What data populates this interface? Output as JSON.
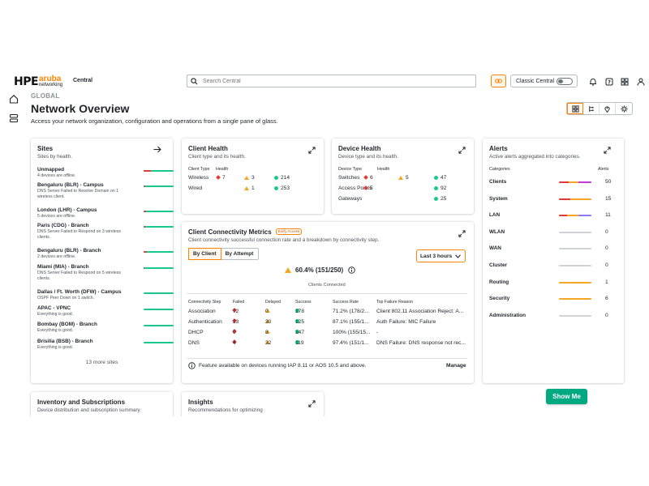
{
  "header": {
    "logo_hpe": "HPE",
    "logo_aruba": "aruba",
    "logo_networking": "networking",
    "app_name": "Central",
    "search_placeholder": "Search Central",
    "classic_label": "Classic Central"
  },
  "page": {
    "breadcrumb": "GLOBAL",
    "title": "Network Overview",
    "subtitle": "Access your network organization, configuration and operations from a single pane of glass."
  },
  "sites": {
    "title": "Sites",
    "subtitle": "Sites by health.",
    "items": [
      {
        "name": "Unmapped",
        "desc": "4 devices are offline.",
        "red": 0.25
      },
      {
        "name": "Bengaluru (BLR) - Campus",
        "desc": "DNS Server Failed to Resolve Domain on 1 wireless client.",
        "red": 0.05
      },
      {
        "name": "London (LHR) - Campus",
        "desc": "5 devices are offline.",
        "red": 0.08
      },
      {
        "name": "Paris (CDG) - Branch",
        "desc": "DNS Server Failed to Respond on 3 wireless clients.",
        "red": 0.05
      },
      {
        "name": "Bengaluru (BLR) - Branch",
        "desc": "2 devices are offline.",
        "red": 0.1
      },
      {
        "name": "Miami (MIA) - Branch",
        "desc": "DNS Server Failed to Respond on 5 wireless clients.",
        "red": 0.03
      },
      {
        "name": "Dallas / Ft. Worth (DFW) - Campus",
        "desc": "OSPF Peer Down on 1 switch.",
        "red": 0
      },
      {
        "name": "APAC - VPNC",
        "desc": "Everything is good.",
        "red": 0
      },
      {
        "name": "Bombay (BOM) - Branch",
        "desc": "Everything is good.",
        "red": 0
      },
      {
        "name": "Brisilia (BSB) - Branch",
        "desc": "Everything is good.",
        "red": 0
      }
    ],
    "more": "13 more sites"
  },
  "client_health": {
    "title": "Client Health",
    "subtitle": "Client type and its health.",
    "col_type": "Client Type",
    "col_health": "Health",
    "rows": [
      {
        "type": "Wireless",
        "red": "7",
        "warn": "3",
        "good": "214"
      },
      {
        "type": "Wired",
        "red": "",
        "warn": "1",
        "good": "253"
      }
    ]
  },
  "device_health": {
    "title": "Device Health",
    "subtitle": "Device type and its health.",
    "col_type": "Device Type",
    "col_health": "Health",
    "rows": [
      {
        "type": "Switches",
        "red": "6",
        "warn": "5",
        "good": "47"
      },
      {
        "type": "Access Points",
        "red": "5",
        "warn": "",
        "good": "92"
      },
      {
        "type": "Gateways",
        "red": "",
        "warn": "",
        "good": "25"
      }
    ]
  },
  "connectivity": {
    "title": "Client Connectivity Metrics",
    "badge": "Early Access",
    "subtitle": "Client connectivity successful connection rate and a breakdown by connectivity step.",
    "tab_client": "By Client",
    "tab_attempt": "By Attempt",
    "range": "Last 3 hours",
    "rate": "60.4% (151/250)",
    "rate_label": "Clients Connected",
    "headers": [
      "Connectivity Step",
      "Failed",
      "Delayed",
      "Success",
      "Success Rate",
      "Top Failure Reason"
    ],
    "rows": [
      {
        "step": "Association",
        "failed": "72",
        "delayed": "0",
        "success": "178",
        "rate": "71.2% (178/2...",
        "reason": "Client 802.11 Association Reject: A..."
      },
      {
        "step": "Authentication",
        "failed": "23",
        "delayed": "30",
        "success": "125",
        "rate": "87.1% (155/1...",
        "reason": "Auth Failure: MIC Failure"
      },
      {
        "step": "DHCP",
        "failed": "0",
        "delayed": "8",
        "success": "147",
        "rate": "100% (155/15...",
        "reason": "-"
      },
      {
        "step": "DNS",
        "failed": "4",
        "delayed": "32",
        "success": "119",
        "rate": "97.4% (151/1...",
        "reason": "DNS Failure: DNS response not rec..."
      }
    ],
    "footer_note": "Feature available on devices running IAP 8.11 or AOS 10.5 and above.",
    "manage": "Manage"
  },
  "alerts": {
    "title": "Alerts",
    "subtitle": "Active alerts aggregated into categories.",
    "col_category": "Categories",
    "col_alerts": "Alerts",
    "items": [
      {
        "name": "Clients",
        "count": "50"
      },
      {
        "name": "System",
        "count": "15"
      },
      {
        "name": "LAN",
        "count": "11"
      },
      {
        "name": "WLAN",
        "count": "0"
      },
      {
        "name": "WAN",
        "count": "0"
      },
      {
        "name": "Cluster",
        "count": "0"
      },
      {
        "name": "Routing",
        "count": "1"
      },
      {
        "name": "Security",
        "count": "6"
      },
      {
        "name": "Administration",
        "count": "0"
      }
    ]
  },
  "inventory": {
    "title": "Inventory and Subscriptions",
    "subtitle": "Device distribution and subscription summary."
  },
  "insights": {
    "title": "Insights",
    "subtitle": "Recommendations for optimizing"
  },
  "show_me": "Show Me",
  "colors": {
    "accent": "#ff8300",
    "good": "#18c98b",
    "bad": "#e23a3a",
    "warn": "#f5a623",
    "cta": "#01a982"
  }
}
